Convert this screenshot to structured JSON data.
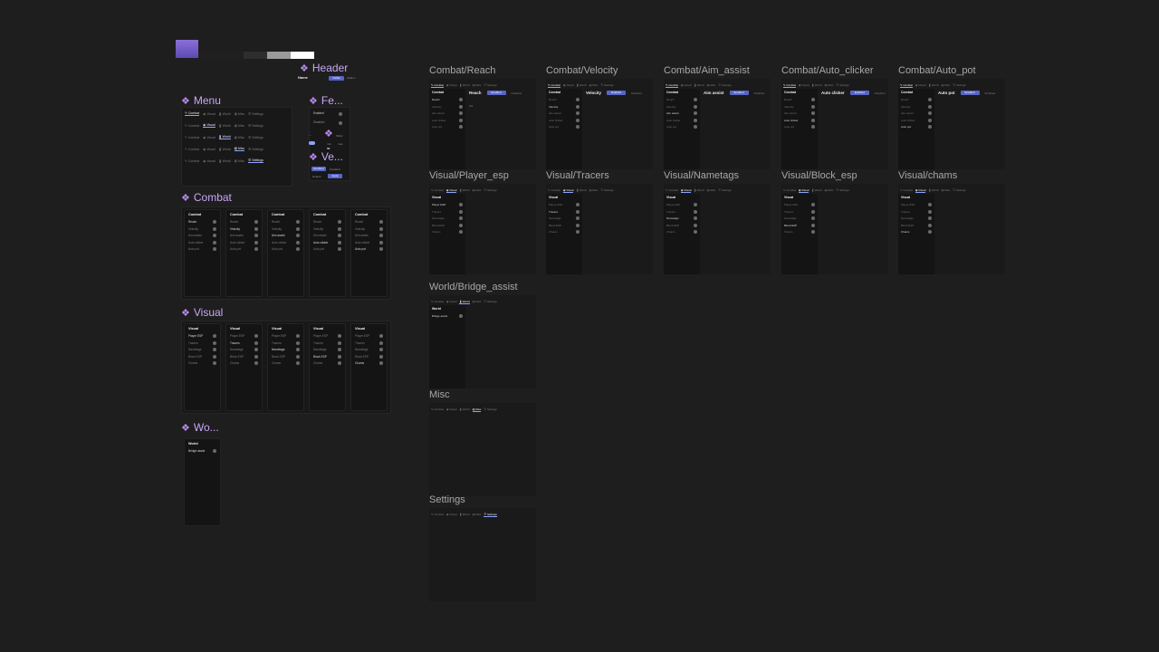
{
  "colors": {
    "background": "#1e1e1e",
    "section_title": "#c9a6f7",
    "frame_title": "#a8a8a8",
    "accent_blue": "#5865c7",
    "swatches": [
      "#8b6fd8",
      "#262626",
      "#3a3a3a",
      "#d0d0d0",
      "#ffffff"
    ]
  },
  "sections": {
    "header": "Header",
    "menu": "Menu",
    "features": "Fe...",
    "values": "Ve...",
    "combat": "Combat",
    "visual": "Visual",
    "world": "Wo..."
  },
  "header_component": {
    "name_label": "Name",
    "button_on": "Visible",
    "button_off": "Hidden"
  },
  "menu_tabs": [
    "Combat",
    "Visual",
    "World",
    "Misc",
    "Settings"
  ],
  "features_component": {
    "row1": "Enabled",
    "row2": "Disabled",
    "ellipsis": "...",
    "label": "Slider",
    "value_labels": [
      "min",
      "max"
    ],
    "value": "50"
  },
  "values_component": {
    "button1": "Enabled",
    "button2": "Disabled",
    "button3": "Default",
    "button4": "Apply"
  },
  "combat_list": {
    "heading": "Combat",
    "items": [
      "Reach",
      "Velocity",
      "Aim assist",
      "Auto clicker",
      "Auto pot"
    ]
  },
  "visual_list": {
    "heading": "Visual",
    "items": [
      "Player ESP",
      "Tracers",
      "Nametags",
      "Block ESP",
      "Chams"
    ]
  },
  "world_list": {
    "heading": "World",
    "items": [
      "Bridge assist"
    ]
  },
  "frames": [
    {
      "title": "Combat/Reach",
      "tab": 0,
      "list": "combat",
      "active": 0,
      "content": "Reach"
    },
    {
      "title": "Combat/Velocity",
      "tab": 0,
      "list": "combat",
      "active": 1,
      "content": "Velocity"
    },
    {
      "title": "Combat/Aim_assist",
      "tab": 0,
      "list": "combat",
      "active": 2,
      "content": "Aim assist"
    },
    {
      "title": "Combat/Auto_clicker",
      "tab": 0,
      "list": "combat",
      "active": 3,
      "content": "Auto clicker"
    },
    {
      "title": "Combat/Auto_pot",
      "tab": 0,
      "list": "combat",
      "active": 4,
      "content": "Auto pot"
    },
    {
      "title": "Visual/Player_esp",
      "tab": 1,
      "list": "visual",
      "active": 0,
      "content": ""
    },
    {
      "title": "Visual/Tracers",
      "tab": 1,
      "list": "visual",
      "active": 1,
      "content": ""
    },
    {
      "title": "Visual/Nametags",
      "tab": 1,
      "list": "visual",
      "active": 2,
      "content": ""
    },
    {
      "title": "Visual/Block_esp",
      "tab": 1,
      "list": "visual",
      "active": 3,
      "content": ""
    },
    {
      "title": "Visual/chams",
      "tab": 1,
      "list": "visual",
      "active": 4,
      "content": ""
    },
    {
      "title": "World/Bridge_assist",
      "tab": 2,
      "list": "world",
      "active": 0,
      "content": ""
    },
    {
      "title": "Misc",
      "tab": 3,
      "list": "",
      "active": -1,
      "content": ""
    },
    {
      "title": "Settings",
      "tab": 4,
      "list": "",
      "active": -1,
      "content": ""
    }
  ],
  "reach_value": "3.0"
}
